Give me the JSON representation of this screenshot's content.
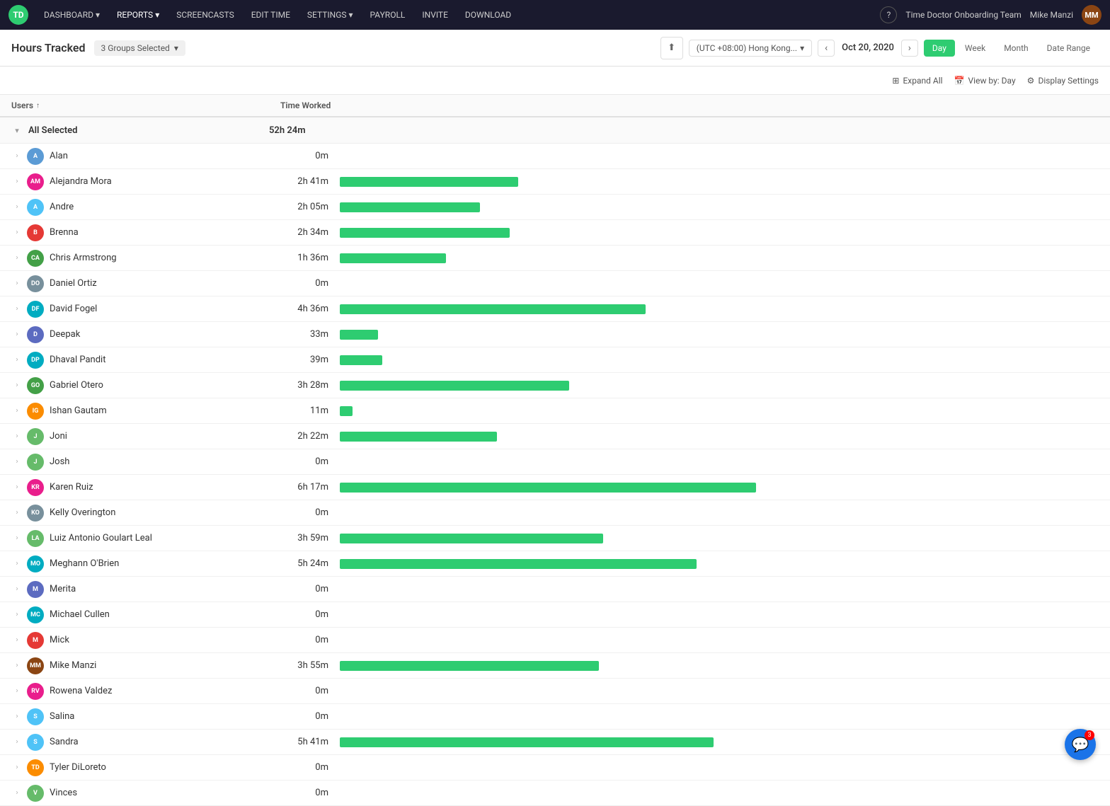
{
  "nav": {
    "logo": "TD",
    "items": [
      {
        "label": "DASHBOARD",
        "hasDropdown": true,
        "active": false
      },
      {
        "label": "REPORTS",
        "hasDropdown": true,
        "active": true
      },
      {
        "label": "SCREENCASTS",
        "hasDropdown": false,
        "active": false
      },
      {
        "label": "EDIT TIME",
        "hasDropdown": false,
        "active": false
      },
      {
        "label": "SETTINGS",
        "hasDropdown": true,
        "active": false
      },
      {
        "label": "PAYROLL",
        "hasDropdown": false,
        "active": false
      },
      {
        "label": "INVITE",
        "hasDropdown": false,
        "active": false
      },
      {
        "label": "DOWNLOAD",
        "hasDropdown": false,
        "active": false
      }
    ],
    "team": "Time Doctor Onboarding Team",
    "user": "Mike Manzi",
    "userInitials": "MM"
  },
  "subheader": {
    "title": "Hours Tracked",
    "groups": "3 Groups Selected",
    "timezone": "(UTC +08:00) Hong Kong...",
    "date": "Oct 20, 2020",
    "periods": [
      "Day",
      "Week",
      "Month",
      "Date Range"
    ],
    "activePeriod": "Day"
  },
  "toolbar": {
    "expandAll": "Expand All",
    "viewByDay": "View by: Day",
    "displaySettings": "Display Settings"
  },
  "table": {
    "colUsers": "Users",
    "colTimeWorked": "Time Worked",
    "allSelectedLabel": "All Selected",
    "allSelectedTime": "52h 24m",
    "users": [
      {
        "name": "Alan",
        "time": "0m",
        "initials": "A",
        "color": "#5b9bd5",
        "barPct": 0
      },
      {
        "name": "Alejandra Mora",
        "time": "2h 41m",
        "initials": "AM",
        "color": "#e91e8c",
        "barPct": 42
      },
      {
        "name": "Andre",
        "time": "2h 05m",
        "initials": "A",
        "color": "#4fc3f7",
        "barPct": 33
      },
      {
        "name": "Brenna",
        "time": "2h 34m",
        "initials": "B",
        "color": "#e53935",
        "barPct": 40
      },
      {
        "name": "Chris Armstrong",
        "time": "1h 36m",
        "initials": "CA",
        "color": "#43a047",
        "barPct": 25
      },
      {
        "name": "Daniel Ortiz",
        "time": "0m",
        "initials": "DO",
        "color": "#78909c",
        "barPct": 0
      },
      {
        "name": "David Fogel",
        "time": "4h 36m",
        "initials": "DF",
        "color": "#00acc1",
        "barPct": 72
      },
      {
        "name": "Deepak",
        "time": "33m",
        "initials": "D",
        "color": "#5c6bc0",
        "barPct": 9
      },
      {
        "name": "Dhaval Pandit",
        "time": "39m",
        "initials": "DP",
        "color": "#00acc1",
        "barPct": 10
      },
      {
        "name": "Gabriel Otero",
        "time": "3h 28m",
        "initials": "GO",
        "color": "#43a047",
        "barPct": 54
      },
      {
        "name": "Ishan Gautam",
        "time": "11m",
        "initials": "IG",
        "color": "#fb8c00",
        "barPct": 3
      },
      {
        "name": "Joni",
        "time": "2h 22m",
        "initials": "J",
        "color": "#66bb6a",
        "barPct": 37
      },
      {
        "name": "Josh",
        "time": "0m",
        "initials": "J",
        "color": "#66bb6a",
        "barPct": 0
      },
      {
        "name": "Karen Ruiz",
        "time": "6h 17m",
        "initials": "KR",
        "color": "#e91e8c",
        "barPct": 98
      },
      {
        "name": "Kelly Overington",
        "time": "0m",
        "initials": "KO",
        "color": "#78909c",
        "barPct": 0
      },
      {
        "name": "Luiz Antonio Goulart Leal",
        "time": "3h 59m",
        "initials": "LA",
        "color": "#66bb6a",
        "barPct": 62
      },
      {
        "name": "Meghann O'Brien",
        "time": "5h 24m",
        "initials": "MO",
        "color": "#00acc1",
        "barPct": 84
      },
      {
        "name": "Merita",
        "time": "0m",
        "initials": "M",
        "color": "#5c6bc0",
        "barPct": 0
      },
      {
        "name": "Michael Cullen",
        "time": "0m",
        "initials": "MC",
        "color": "#00acc1",
        "barPct": 0
      },
      {
        "name": "Mick",
        "time": "0m",
        "initials": "M",
        "color": "#e53935",
        "barPct": 0
      },
      {
        "name": "Mike Manzi",
        "time": "3h 55m",
        "initials": "MM",
        "color": "#8B4513",
        "barPct": 61
      },
      {
        "name": "Rowena Valdez",
        "time": "0m",
        "initials": "RV",
        "color": "#e91e8c",
        "barPct": 0
      },
      {
        "name": "Salina",
        "time": "0m",
        "initials": "S",
        "color": "#4fc3f7",
        "barPct": 0
      },
      {
        "name": "Sandra",
        "time": "5h 41m",
        "initials": "S",
        "color": "#4fc3f7",
        "barPct": 88
      },
      {
        "name": "Tyler DiLoreto",
        "time": "0m",
        "initials": "TD",
        "color": "#fb8c00",
        "barPct": 0
      },
      {
        "name": "Vinces",
        "time": "0m",
        "initials": "V",
        "color": "#66bb6a",
        "barPct": 0
      }
    ]
  },
  "chat": {
    "badge": "3"
  }
}
